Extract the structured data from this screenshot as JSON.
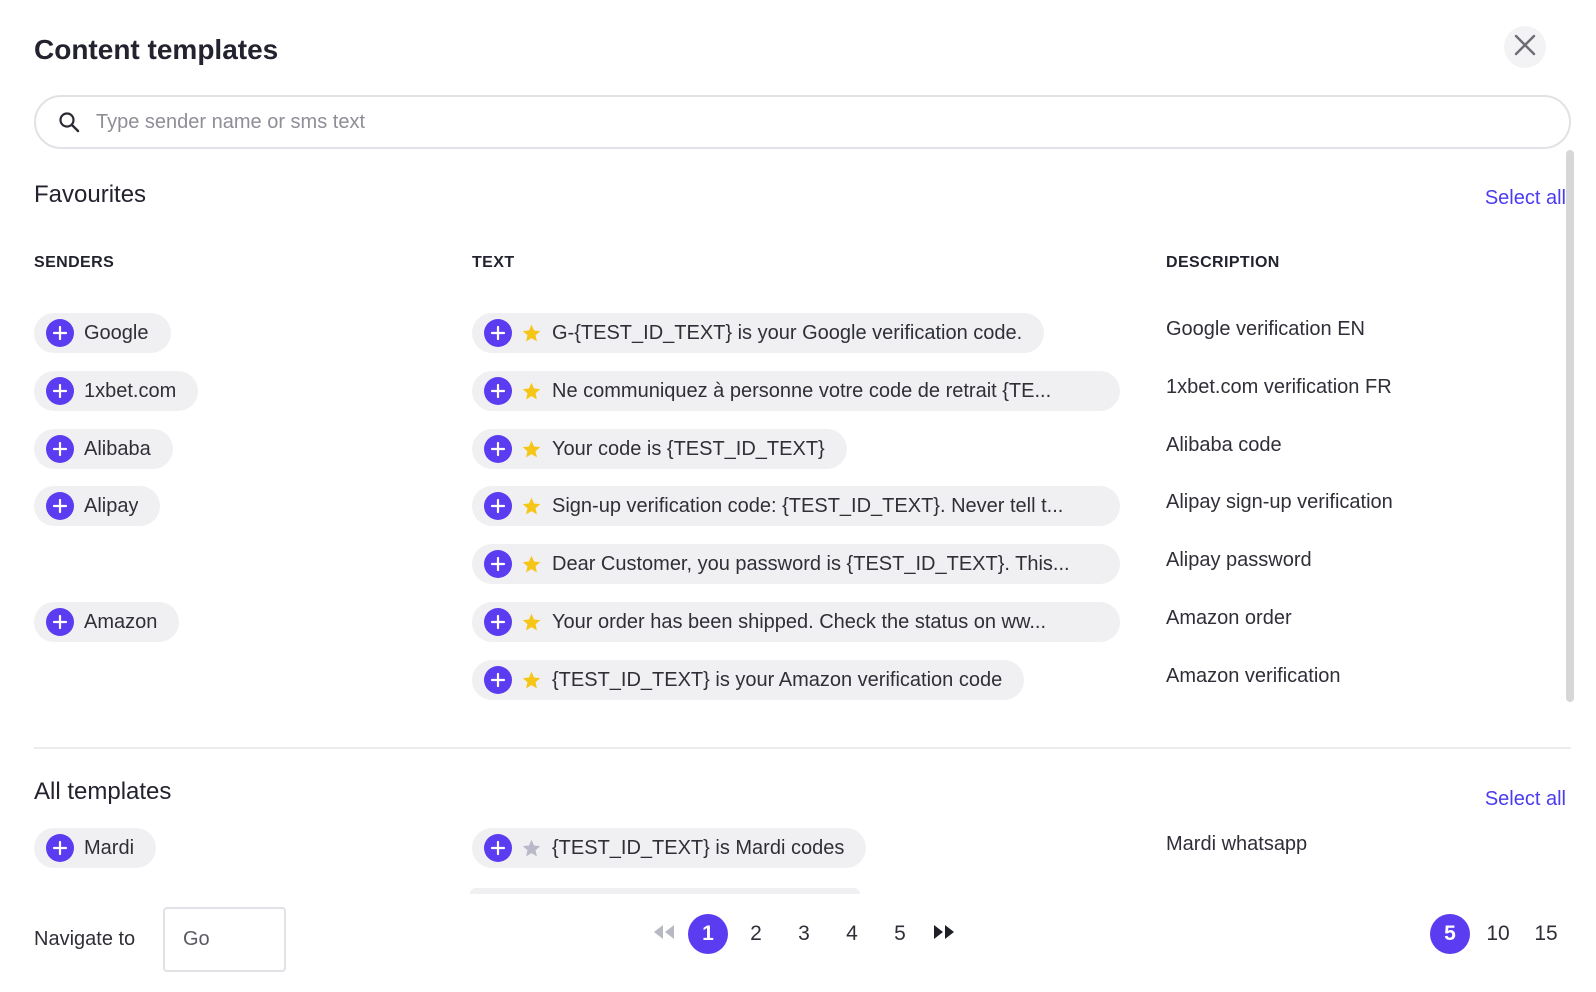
{
  "header": {
    "title": "Content templates"
  },
  "search": {
    "placeholder": "Type sender name or sms text"
  },
  "favourites": {
    "title": "Favourites",
    "select_all": "Select all",
    "columns": {
      "senders": "SENDERS",
      "text": "TEXT",
      "description": "DESCRIPTION"
    },
    "rows": [
      {
        "sender": "Google",
        "text": "G-{TEST_ID_TEXT} is your Google verification code.",
        "description": "Google verification EN"
      },
      {
        "sender": "1xbet.com",
        "text": "Ne communiquez à personne votre code de retrait {TE...",
        "description": "1xbet.com verification FR"
      },
      {
        "sender": "Alibaba",
        "text": "Your code is {TEST_ID_TEXT}",
        "description": "Alibaba code"
      },
      {
        "sender": "Alipay",
        "text": "Sign-up verification code: {TEST_ID_TEXT}. Never tell t...",
        "description": "Alipay sign-up verification"
      },
      {
        "sender": "",
        "text": "Dear Customer, you password is {TEST_ID_TEXT}. This...",
        "description": "Alipay password"
      },
      {
        "sender": "Amazon",
        "text": "Your order has been shipped. Check the status on ww...",
        "description": "Amazon order"
      },
      {
        "sender": "",
        "text": "{TEST_ID_TEXT} is your Amazon verification code",
        "description": "Amazon verification"
      }
    ]
  },
  "all_templates": {
    "title": "All templates",
    "select_all": "Select all",
    "rows": [
      {
        "sender": "Mardi",
        "text": "{TEST_ID_TEXT} is Mardi codes",
        "description": "Mardi whatsapp"
      }
    ]
  },
  "footer": {
    "navigate_label": "Navigate to",
    "navigate_placeholder": "Go",
    "pages": [
      "1",
      "2",
      "3",
      "4",
      "5"
    ],
    "current_page": "1",
    "page_sizes": [
      "5",
      "10",
      "15"
    ],
    "current_page_size": "5"
  },
  "colors": {
    "accent": "#5b3cf0",
    "link": "#4b3bf0",
    "star_favourite": "#f5c518",
    "star_default": "#b8b8c8",
    "chip_bg": "#f0f0f2"
  },
  "icons": {
    "close": "close-icon",
    "search": "search-icon",
    "add": "plus-icon",
    "favourite": "star-icon",
    "first_page": "double-chevron-left-icon",
    "last_page": "double-chevron-right-icon"
  }
}
